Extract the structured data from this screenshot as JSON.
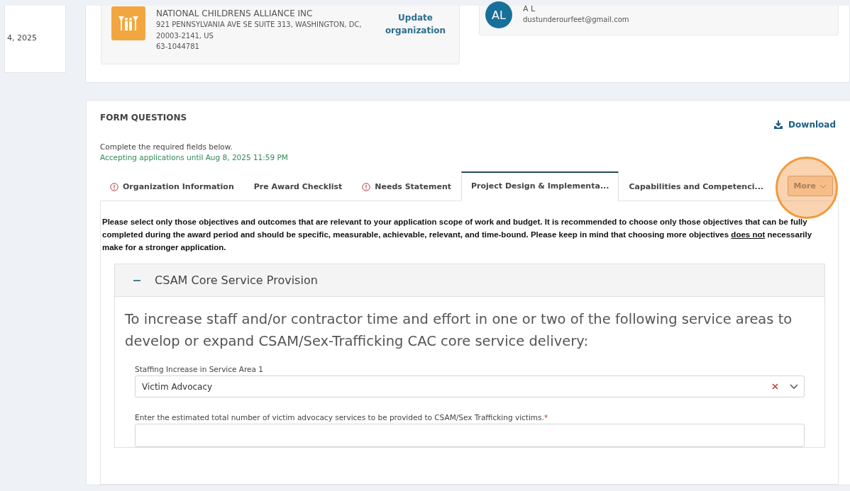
{
  "side_card": {
    "date": "4, 2025"
  },
  "organization": {
    "name": "NATIONAL CHILDRENS ALLIANCE INC",
    "address_line_1": "921 PENNSYLVANIA AVE SE SUITE 313, WASHINGTON, DC,",
    "address_line_2": "20003-2141, US",
    "ein": "63-1044781",
    "update_link": "Update organization"
  },
  "contact": {
    "initials": "AL",
    "name": "A L",
    "email": "dustunderourfeet@gmail.com"
  },
  "form": {
    "title": "FORM QUESTIONS",
    "download": "Download",
    "instructions": "Complete the required fields below.",
    "deadline": "Accepting applications until Aug 8, 2025 11:59 PM",
    "tabs": [
      {
        "label": "Organization Information",
        "warning": true,
        "selected": false
      },
      {
        "label": "Pre Award Checklist",
        "warning": false,
        "selected": false
      },
      {
        "label": "Needs Statement",
        "warning": true,
        "selected": false
      },
      {
        "label": "Project Design & Implementa...",
        "warning": false,
        "selected": true
      },
      {
        "label": "Capabilities and Competenci...",
        "warning": false,
        "selected": false
      }
    ],
    "more_button": "More",
    "more_highlighted": true,
    "notice": {
      "before": "Please select only those objectives and outcomes that are relevant to your application scope of work and budget. It is recommended to choose only those objectives that can be fully completed during the award period and should be specific, measurable, achievable, relevant, and time-bound. Please keep in mind that choosing more objectives ",
      "underlined": "does not",
      "after": " necessarily make for a stronger application."
    },
    "section": {
      "title": "CSAM Core Service Provision",
      "expanded": true,
      "heading": "To increase staff and/or contractor time and effort in one or two of the following service areas to develop or expand CSAM/Sex-Trafficking CAC core service delivery:",
      "fields": [
        {
          "kind": "select",
          "label": "Staffing Increase in Service Area 1",
          "value": "Victim Advocacy"
        },
        {
          "kind": "text",
          "label": "Enter the estimated total number of victim advocacy services to be provided to CSAM/Sex Trafficking victims.",
          "required_mark": "*"
        }
      ]
    }
  }
}
